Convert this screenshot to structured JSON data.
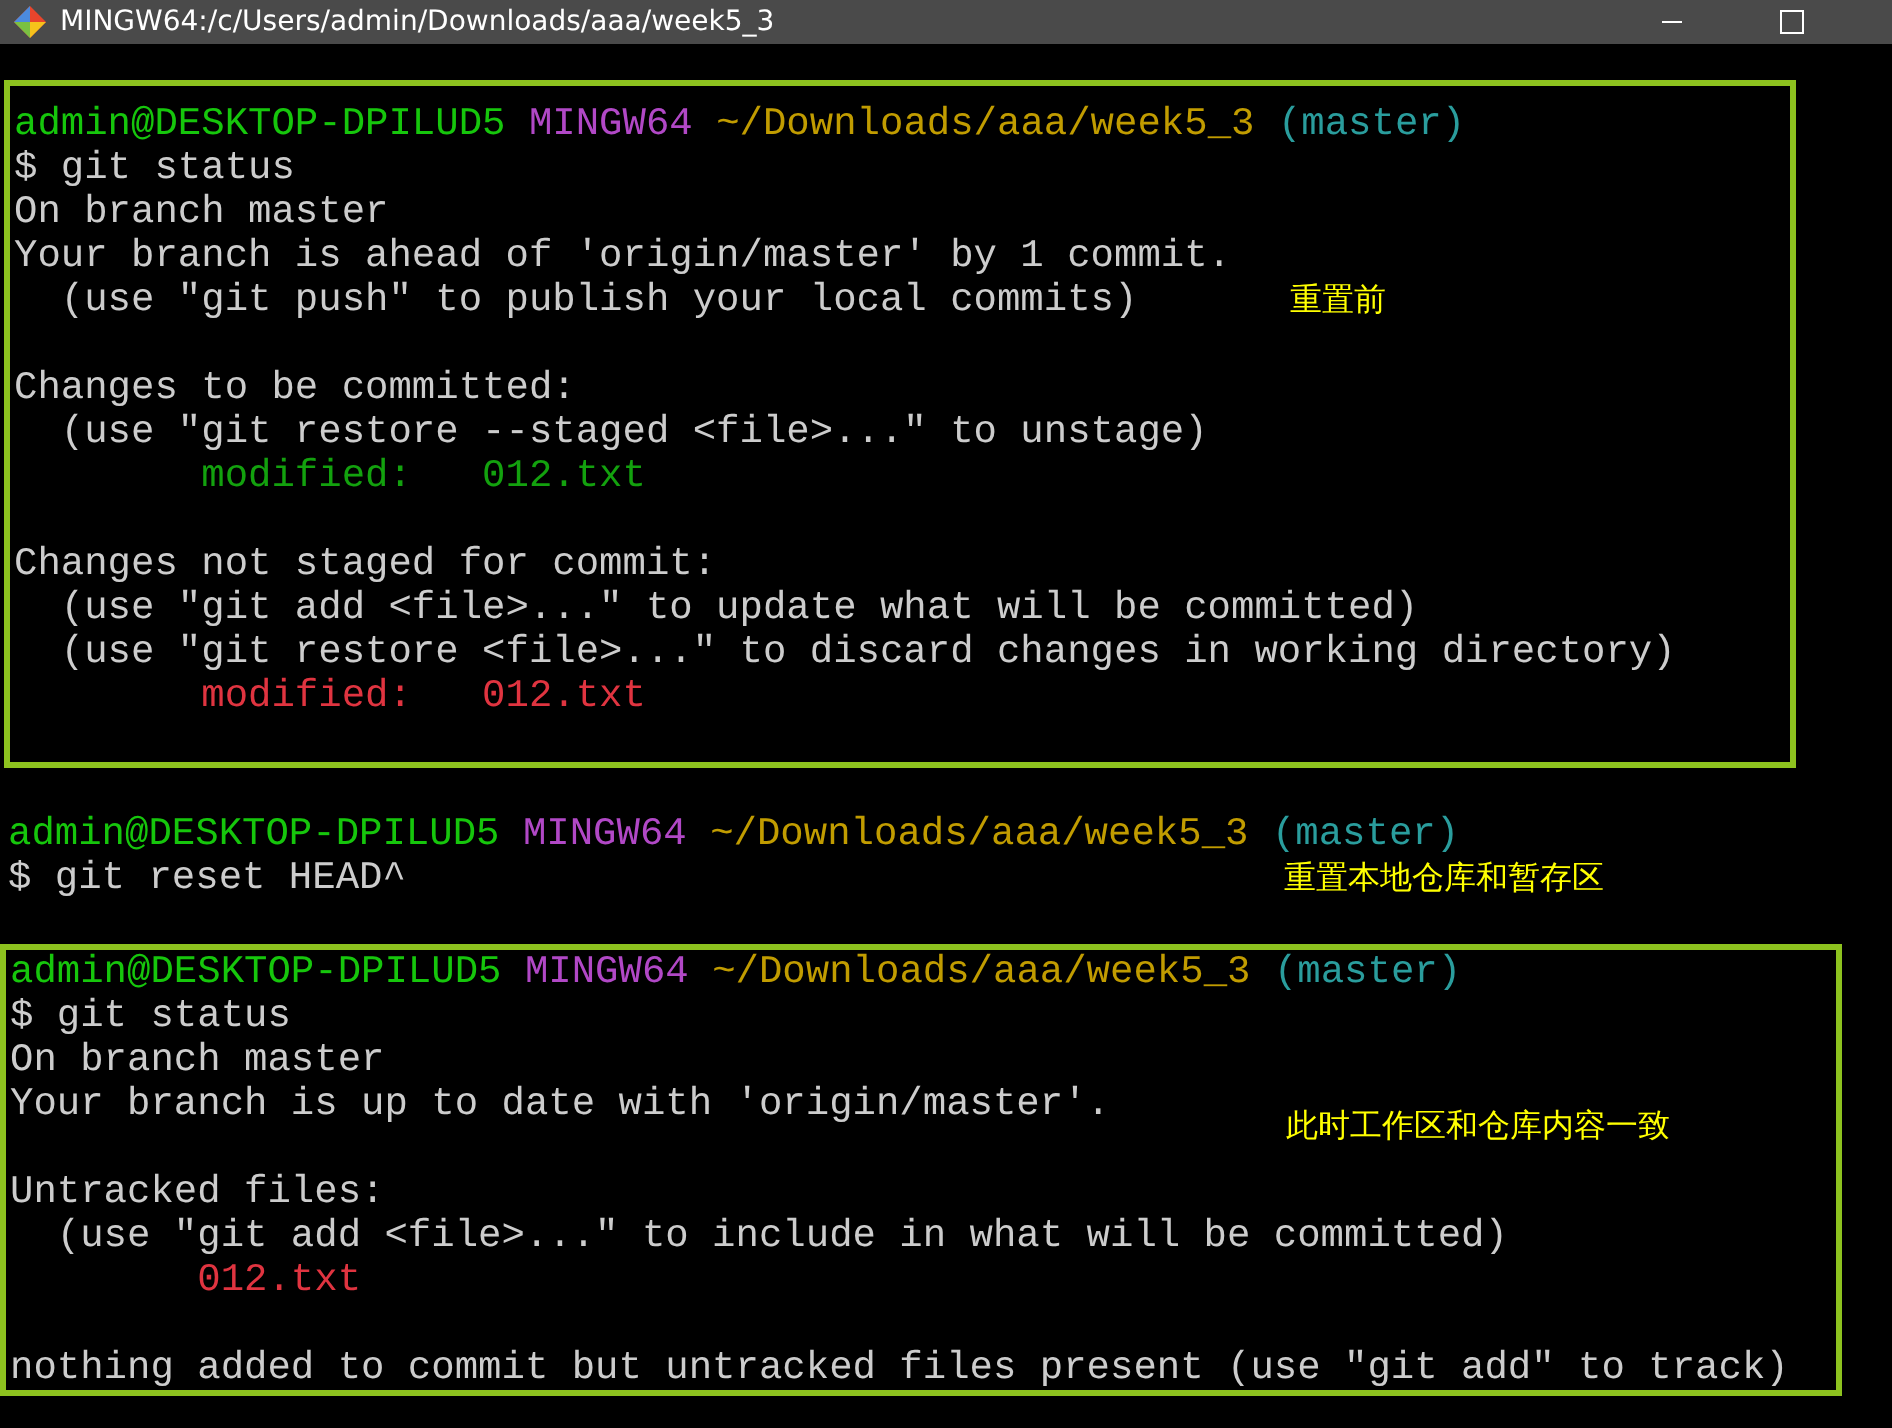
{
  "window": {
    "title": "MINGW64:/c/Users/admin/Downloads/aaa/week5_3"
  },
  "blocks": [
    {
      "boxed": true,
      "paragraphs": [
        {
          "lines": [
            {
              "segments": [
                {
                  "kind": "user",
                  "text": "admin@DESKTOP-DPILUD5"
                },
                {
                  "kind": "host",
                  "text": "MINGW64"
                },
                {
                  "kind": "path",
                  "text": "~/Downloads/aaa/week5_3"
                },
                {
                  "kind": "branch",
                  "text": "(master)"
                }
              ]
            },
            {
              "segments": [
                {
                  "kind": "plain",
                  "text": "$ git status"
                }
              ]
            },
            {
              "segments": [
                {
                  "kind": "plain",
                  "text": "On branch master"
                }
              ]
            },
            {
              "segments": [
                {
                  "kind": "plain",
                  "text": "Your branch is ahead of 'origin/master' by 1 commit."
                }
              ]
            },
            {
              "segments": [
                {
                  "kind": "plain",
                  "text": "  (use \"git push\" to publish your local commits)"
                }
              ],
              "note": "重置前"
            }
          ]
        },
        {
          "lines": [
            {
              "segments": [
                {
                  "kind": "plain",
                  "text": "Changes to be committed:"
                }
              ]
            },
            {
              "segments": [
                {
                  "kind": "plain",
                  "text": "  (use \"git restore --staged <file>...\" to unstage)"
                }
              ]
            },
            {
              "segments": [
                {
                  "kind": "staged",
                  "text": "        modified:   012.txt"
                }
              ]
            }
          ]
        },
        {
          "lines": [
            {
              "segments": [
                {
                  "kind": "plain",
                  "text": "Changes not staged for commit:"
                }
              ]
            },
            {
              "segments": [
                {
                  "kind": "plain",
                  "text": "  (use \"git add <file>...\" to update what will be committed)"
                }
              ]
            },
            {
              "segments": [
                {
                  "kind": "plain",
                  "text": "  (use \"git restore <file>...\" to discard changes in working directory)"
                }
              ]
            },
            {
              "segments": [
                {
                  "kind": "unstaged",
                  "text": "        modified:   012.txt"
                }
              ]
            }
          ]
        }
      ]
    },
    {
      "boxed": false,
      "paragraphs": [
        {
          "lines": [
            {
              "segments": [
                {
                  "kind": "user",
                  "text": "admin@DESKTOP-DPILUD5"
                },
                {
                  "kind": "host",
                  "text": "MINGW64"
                },
                {
                  "kind": "path",
                  "text": "~/Downloads/aaa/week5_3"
                },
                {
                  "kind": "branch",
                  "text": "(master)"
                }
              ]
            },
            {
              "segments": [
                {
                  "kind": "plain",
                  "text": "$ git reset HEAD^"
                }
              ],
              "note": "重置本地仓库和暂存区"
            }
          ]
        }
      ]
    },
    {
      "boxed": true,
      "paragraphs": [
        {
          "lines": [
            {
              "segments": [
                {
                  "kind": "user",
                  "text": "admin@DESKTOP-DPILUD5"
                },
                {
                  "kind": "host",
                  "text": "MINGW64"
                },
                {
                  "kind": "path",
                  "text": "~/Downloads/aaa/week5_3"
                },
                {
                  "kind": "branch",
                  "text": "(master)"
                }
              ]
            },
            {
              "segments": [
                {
                  "kind": "plain",
                  "text": "$ git status"
                }
              ]
            },
            {
              "segments": [
                {
                  "kind": "plain",
                  "text": "On branch master"
                }
              ]
            },
            {
              "segments": [
                {
                  "kind": "plain",
                  "text": "Your branch is up to date with 'origin/master'."
                }
              ],
              "note": "此时工作区和仓库内容一致"
            }
          ]
        },
        {
          "lines": [
            {
              "segments": [
                {
                  "kind": "plain",
                  "text": "Untracked files:"
                }
              ]
            },
            {
              "segments": [
                {
                  "kind": "plain",
                  "text": "  (use \"git add <file>...\" to include in what will be committed)"
                }
              ]
            },
            {
              "segments": [
                {
                  "kind": "unstaged",
                  "text": "        012.txt"
                }
              ]
            }
          ]
        },
        {
          "lines": [
            {
              "segments": [
                {
                  "kind": "plain",
                  "text": "nothing added to commit but untracked files present (use \"git add\" to track)"
                }
              ]
            }
          ]
        }
      ]
    }
  ]
}
